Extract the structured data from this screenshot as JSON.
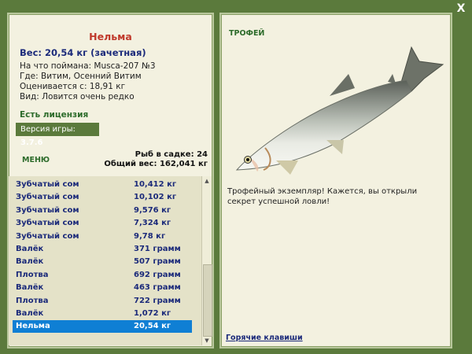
{
  "close_label": "X",
  "fish": {
    "name": "Нельма",
    "weight": "Вес: 20,54 кг (зачетная)",
    "caught_with": "На что поймана: Musca-207 №3",
    "location": "Где: Витим, Осенний Витим",
    "value": "Оценивается с: 18,91 кг",
    "rarity": "Вид: Ловится очень редко"
  },
  "license": "Есть лицензия",
  "version": {
    "label": "Версия игры:",
    "number": "3.7.6"
  },
  "menu_label": "МЕНЮ",
  "keepnet": {
    "count": "Рыб в садке: 24",
    "total": "Общий вес: 162,041 кг"
  },
  "catch_list": [
    {
      "name": "Зубчатый сом",
      "weight": "10,412 кг"
    },
    {
      "name": "Зубчатый сом",
      "weight": "10,102 кг"
    },
    {
      "name": "Зубчатый сом",
      "weight": "9,576 кг"
    },
    {
      "name": "Зубчатый сом",
      "weight": "7,324 кг"
    },
    {
      "name": "Зубчатый сом",
      "weight": "9,78 кг"
    },
    {
      "name": "Валёк",
      "weight": "371 грамм"
    },
    {
      "name": "Валёк",
      "weight": "507 грамм"
    },
    {
      "name": "Плотва",
      "weight": "692 грамм"
    },
    {
      "name": "Валёк",
      "weight": "463 грамм"
    },
    {
      "name": "Плотва",
      "weight": "722 грамм"
    },
    {
      "name": "Валёк",
      "weight": "1,072 кг"
    },
    {
      "name": "Нельма",
      "weight": "20,54 кг"
    }
  ],
  "trophy": {
    "label": "ТРОФЕЙ",
    "text": "Трофейный экземпляр! Кажется, вы открыли секрет успешной ловли!"
  },
  "hotkeys_label": "Горячие клавиши",
  "colors": {
    "background": "#5b7a3c",
    "panel": "#f3f1e0",
    "selected_row": "#0f7fd4",
    "fish_name": "#c0392b",
    "list_text": "#1b2a7a"
  }
}
